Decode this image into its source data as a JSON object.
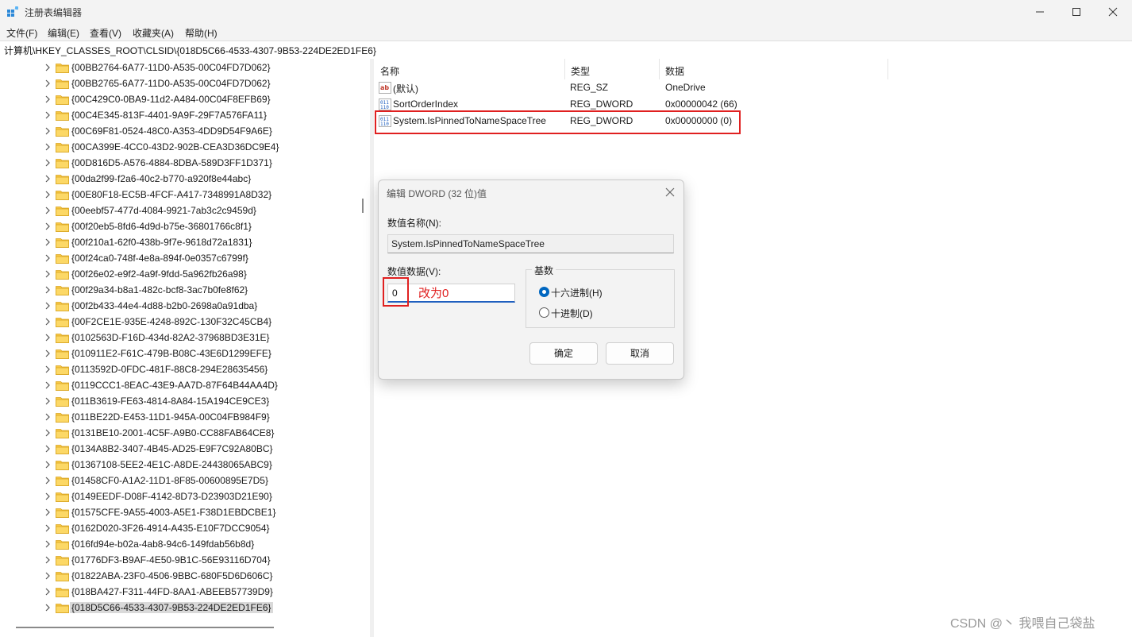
{
  "window": {
    "title": "注册表编辑器",
    "minimize_icon": "minimize-icon",
    "maximize_icon": "maximize-icon",
    "close_icon": "close-icon"
  },
  "menu": [
    "文件(F)",
    "编辑(E)",
    "查看(V)",
    "收藏夹(A)",
    "帮助(H)"
  ],
  "address": "计算机\\HKEY_CLASSES_ROOT\\CLSID\\{018D5C66-4533-4307-9B53-224DE2ED1FE6}",
  "tree": {
    "items": [
      "{00BB2764-6A77-11D0-A535-00C04FD7D062}",
      "{00BB2765-6A77-11D0-A535-00C04FD7D062}",
      "{00C429C0-0BA9-11d2-A484-00C04F8EFB69}",
      "{00C4E345-813F-4401-9A9F-29F7A576FA11}",
      "{00C69F81-0524-48C0-A353-4DD9D54F9A6E}",
      "{00CA399E-4CC0-43D2-902B-CEA3D36DC9E4}",
      "{00D816D5-A576-4884-8DBA-589D3FF1D371}",
      "{00da2f99-f2a6-40c2-b770-a920f8e44abc}",
      "{00E80F18-EC5B-4FCF-A417-7348991A8D32}",
      "{00eebf57-477d-4084-9921-7ab3c2c9459d}",
      "{00f20eb5-8fd6-4d9d-b75e-36801766c8f1}",
      "{00f210a1-62f0-438b-9f7e-9618d72a1831}",
      "{00f24ca0-748f-4e8a-894f-0e0357c6799f}",
      "{00f26e02-e9f2-4a9f-9fdd-5a962fb26a98}",
      "{00f29a34-b8a1-482c-bcf8-3ac7b0fe8f62}",
      "{00f2b433-44e4-4d88-b2b0-2698a0a91dba}",
      "{00F2CE1E-935E-4248-892C-130F32C45CB4}",
      "{0102563D-F16D-434d-82A2-37968BD3E31E}",
      "{010911E2-F61C-479B-B08C-43E6D1299EFE}",
      "{0113592D-0FDC-481F-88C8-294E28635456}",
      "{0119CCC1-8EAC-43E9-AA7D-87F64B44AA4D}",
      "{011B3619-FE63-4814-8A84-15A194CE9CE3}",
      "{011BE22D-E453-11D1-945A-00C04FB984F9}",
      "{0131BE10-2001-4C5F-A9B0-CC88FAB64CE8}",
      "{0134A8B2-3407-4B45-AD25-E9F7C92A80BC}",
      "{01367108-5EE2-4E1C-A8DE-24438065ABC9}",
      "{01458CF0-A1A2-11D1-8F85-00600895E7D5}",
      "{0149EEDF-D08F-4142-8D73-D23903D21E90}",
      "{01575CFE-9A55-4003-A5E1-F38D1EBDCBE1}",
      "{0162D020-3F26-4914-A435-E10F7DCC9054}",
      "{016fd94e-b02a-4ab8-94c6-149fdab56b8d}",
      "{01776DF3-B9AF-4E50-9B1C-56E93116D704}",
      "{01822ABA-23F0-4506-9BBC-680F5D6D606C}",
      "{018BA427-F311-44FD-8AA1-ABEEB57739D9}",
      "{018D5C66-4533-4307-9B53-224DE2ED1FE6}"
    ],
    "selected_index": 34
  },
  "list": {
    "headers": [
      "名称",
      "类型",
      "数据"
    ],
    "rows": [
      {
        "icon": "string-value-icon",
        "name": "(默认)",
        "type": "REG_SZ",
        "data": "OneDrive"
      },
      {
        "icon": "binary-value-icon",
        "name": "SortOrderIndex",
        "type": "REG_DWORD",
        "data": "0x00000042 (66)"
      },
      {
        "icon": "binary-value-icon",
        "name": "System.IsPinnedToNameSpaceTree",
        "type": "REG_DWORD",
        "data": "0x00000000 (0)"
      }
    ]
  },
  "dialog": {
    "title": "编辑 DWORD (32 位)值",
    "name_label": "数值名称(N):",
    "name_value": "System.IsPinnedToNameSpaceTree",
    "data_label": "数值数据(V):",
    "data_value": "0",
    "annotation": "改为0",
    "base_label": "基数",
    "radio_hex": "十六进制(H)",
    "radio_dec": "十进制(D)",
    "selected_base": "hex",
    "ok_label": "确定",
    "cancel_label": "取消"
  },
  "watermark": "CSDN @丶 我喂自己袋盐",
  "colors": {
    "highlight_red": "#e02020",
    "accent_blue": "#0067c0",
    "folder_yellow": "#f8c846"
  }
}
